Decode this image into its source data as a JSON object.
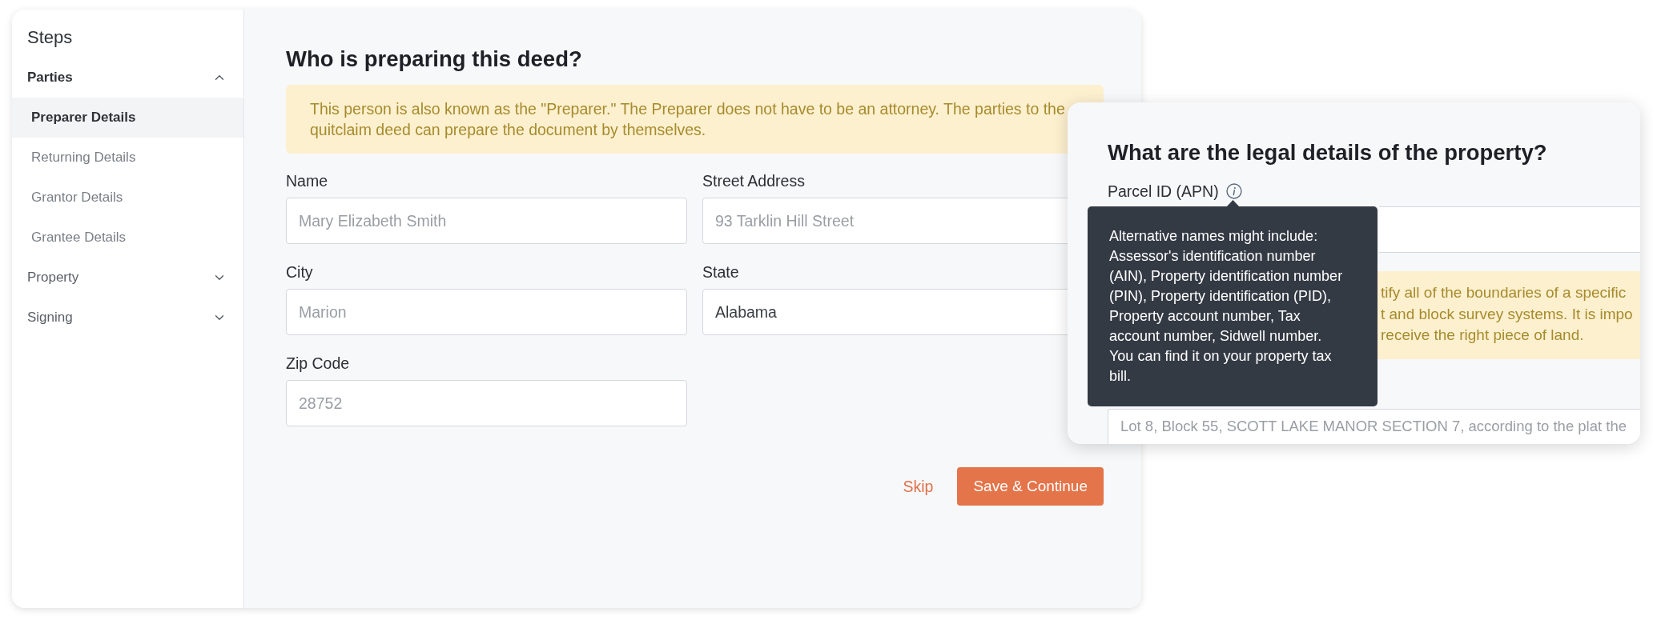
{
  "sidebar": {
    "title": "Steps",
    "groups": [
      {
        "label": "Parties",
        "expanded": true,
        "items": [
          {
            "label": "Preparer Details",
            "selected": true
          },
          {
            "label": "Returning Details",
            "selected": false
          },
          {
            "label": "Grantor Details",
            "selected": false
          },
          {
            "label": "Grantee Details",
            "selected": false
          }
        ]
      },
      {
        "label": "Property",
        "expanded": false
      },
      {
        "label": "Signing",
        "expanded": false
      }
    ]
  },
  "preparer_form": {
    "title": "Who is preparing this deed?",
    "notice": "This person is also known as the \"Preparer.\" The Preparer does not have to be an attorney. The parties to the quitclaim deed can prepare the document by themselves.",
    "fields": [
      {
        "label": "Name",
        "placeholder": "Mary Elizabeth Smith"
      },
      {
        "label": "Street Address",
        "placeholder": "93 Tarklin Hill Street"
      },
      {
        "label": "City",
        "placeholder": "Marion"
      },
      {
        "label": "State",
        "value": "Alabama"
      },
      {
        "label": "Zip Code",
        "placeholder": "28752"
      }
    ],
    "skip_button": "Skip",
    "submit_button": "Save & Continue"
  },
  "property_form": {
    "title": "What are the legal details of the property?",
    "parcel_label": "Parcel ID (APN)",
    "tooltip": "Alternative names might include: Assessor's identification number (AIN), Property identification number (PIN), Property identification (PID), Property account number, Tax account number, Sidwell number. You can find it on your property tax bill.",
    "notice_lines": [
      "tify all of the boundaries of a specific",
      "t and block survey systems. It is impo",
      "receive the right piece of land."
    ],
    "legal_description_placeholder": "Lot 8, Block 55, SCOTT LAKE MANOR SECTION 7, according to the plat the"
  }
}
